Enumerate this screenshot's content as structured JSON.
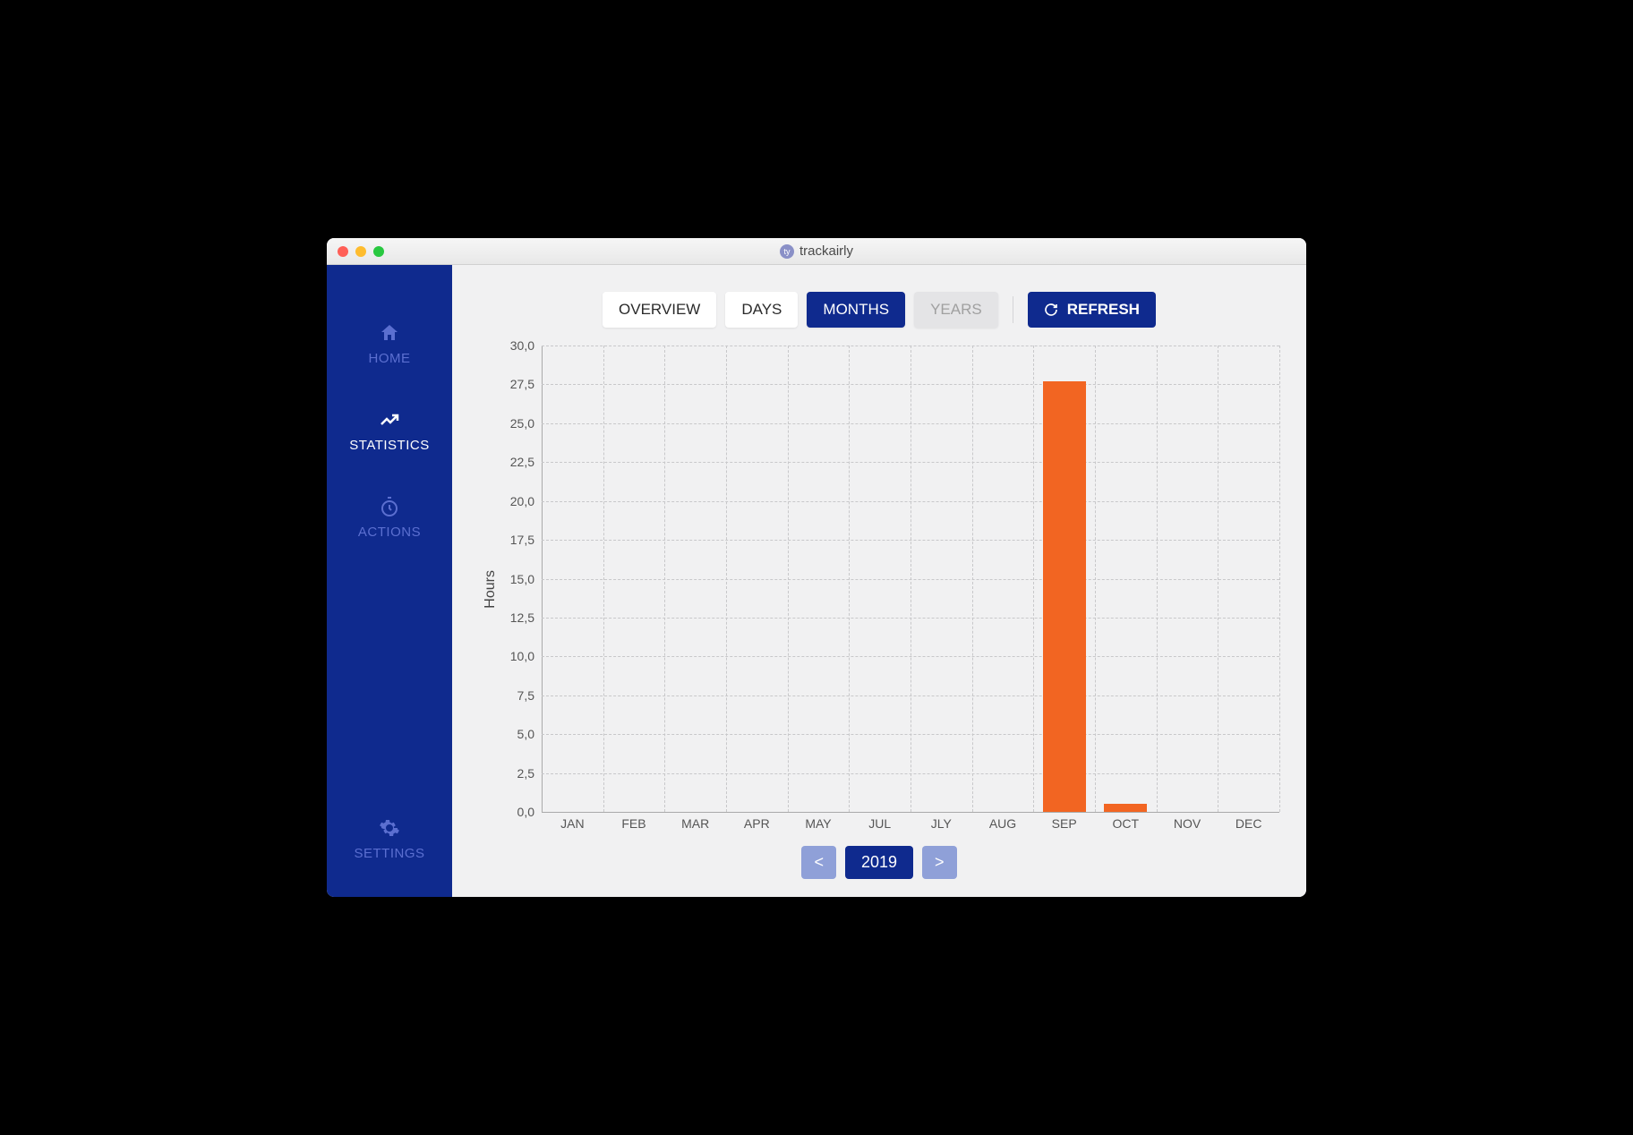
{
  "window": {
    "title": "trackairly"
  },
  "sidebar": {
    "items": [
      {
        "label": "HOME",
        "icon": "home-icon"
      },
      {
        "label": "STATISTICS",
        "icon": "trend-icon"
      },
      {
        "label": "ACTIONS",
        "icon": "stopwatch-icon"
      },
      {
        "label": "SETTINGS",
        "icon": "gear-icon"
      }
    ]
  },
  "toolbar": {
    "overview": "OVERVIEW",
    "days": "DAYS",
    "months": "MONTHS",
    "years": "YEARS",
    "refresh": "REFRESH"
  },
  "year_nav": {
    "prev": "<",
    "year": "2019",
    "next": ">"
  },
  "chart_data": {
    "type": "bar",
    "ylabel": "Hours",
    "ylim": [
      0,
      30
    ],
    "ystep": 2.5,
    "yticks": [
      "0,0",
      "2,5",
      "5,0",
      "7,5",
      "10,0",
      "12,5",
      "15,0",
      "17,5",
      "20,0",
      "22,5",
      "25,0",
      "27,5",
      "30,0"
    ],
    "categories": [
      "JAN",
      "FEB",
      "MAR",
      "APR",
      "MAY",
      "JUL",
      "JLY",
      "AUG",
      "SEP",
      "OCT",
      "NOV",
      "DEC"
    ],
    "values": [
      0,
      0,
      0,
      0,
      0,
      0,
      0,
      0,
      27.7,
      0.5,
      0,
      0
    ],
    "bar_color": "#f26522"
  }
}
